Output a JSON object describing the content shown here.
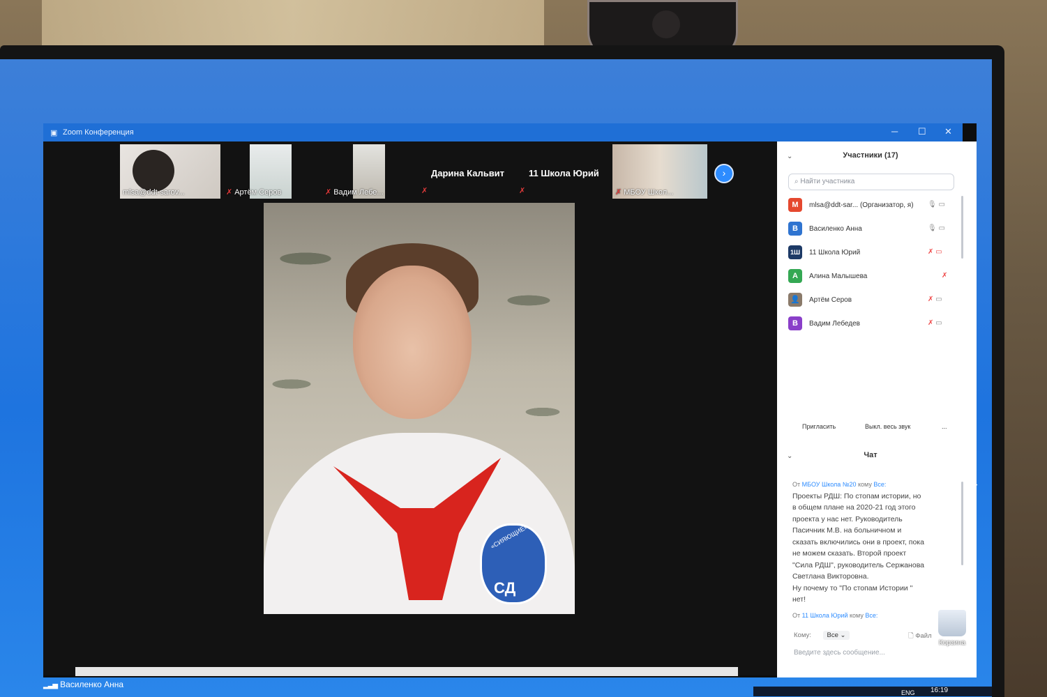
{
  "window": {
    "title": "Zoom Конференция",
    "controls": {
      "minimize": "─",
      "maximize": "☐",
      "close": "✕"
    }
  },
  "thumbnails": [
    {
      "label": "mlsa@ddt-sarov...",
      "muted": false
    },
    {
      "label": "Артём Серов",
      "muted": true
    },
    {
      "label": "Вадим Лебе...",
      "muted": true
    },
    {
      "label": "МБОУ Школ...",
      "muted": true
    }
  ],
  "name_tiles": [
    {
      "label": "Дарина Кальвит"
    },
    {
      "label": "11 Школа Юрий"
    }
  ],
  "main_video": {
    "speaker_name": "Василенко Анна",
    "badge_text": "СД",
    "badge_arc": "«СИЯЮЩИЕ»"
  },
  "participants_panel": {
    "title": "Участники (17)",
    "search_placeholder": "Найти участника",
    "participants": [
      {
        "initial": "M",
        "color": "#e5482f",
        "name": "mlsa@ddt-sar... (Организатор, я)"
      },
      {
        "initial": "В",
        "color": "#2f74d0",
        "name": "Василенко Анна"
      },
      {
        "initial": "1Ш",
        "color": "#1d3a66",
        "name": "11 Школа Юрий"
      },
      {
        "initial": "А",
        "color": "#34a853",
        "name": "Алина Малышева"
      },
      {
        "initial": "",
        "color": "#8a7a6a",
        "name": "Артём Серов"
      },
      {
        "initial": "В",
        "color": "#8a3fc9",
        "name": "Вадим Лебедев"
      }
    ],
    "invite_label": "Пригласить",
    "mute_all_label": "Выкл. весь звук",
    "more_label": "..."
  },
  "chat": {
    "title": "Чат",
    "messages": [
      {
        "from_prefix": "От",
        "from": "МБОУ Школа №20",
        "to_prefix": "кому",
        "to": "Все:",
        "lines": [
          "Проекты РДШ: По стопам истории, но",
          "в общем плане на 2020-21 год этого",
          "проекта у нас нет. Руководитель",
          "Пасичник М.В. на больничном и",
          "сказать включились они в проект, пока",
          "не можем сказать. Второй проект",
          "\"Сила РДШ\", руководитель Сержанова",
          "Светлана Викторовна.",
          "Ну почему то \"По стопам Истории \"",
          "нет!"
        ]
      },
      {
        "from_prefix": "От",
        "from": "11 Школа Юрий",
        "to_prefix": "кому",
        "to": "Все:",
        "lines": []
      }
    ],
    "to_label": "Кому:",
    "to_value": "Все",
    "file_label": "Файл",
    "more_label": "···",
    "input_placeholder": "Введите здесь сообщение..."
  },
  "desktop": {
    "recycle_bin_label": "Корзина",
    "tray_lang": "ENG",
    "tray_time": "16:19"
  }
}
